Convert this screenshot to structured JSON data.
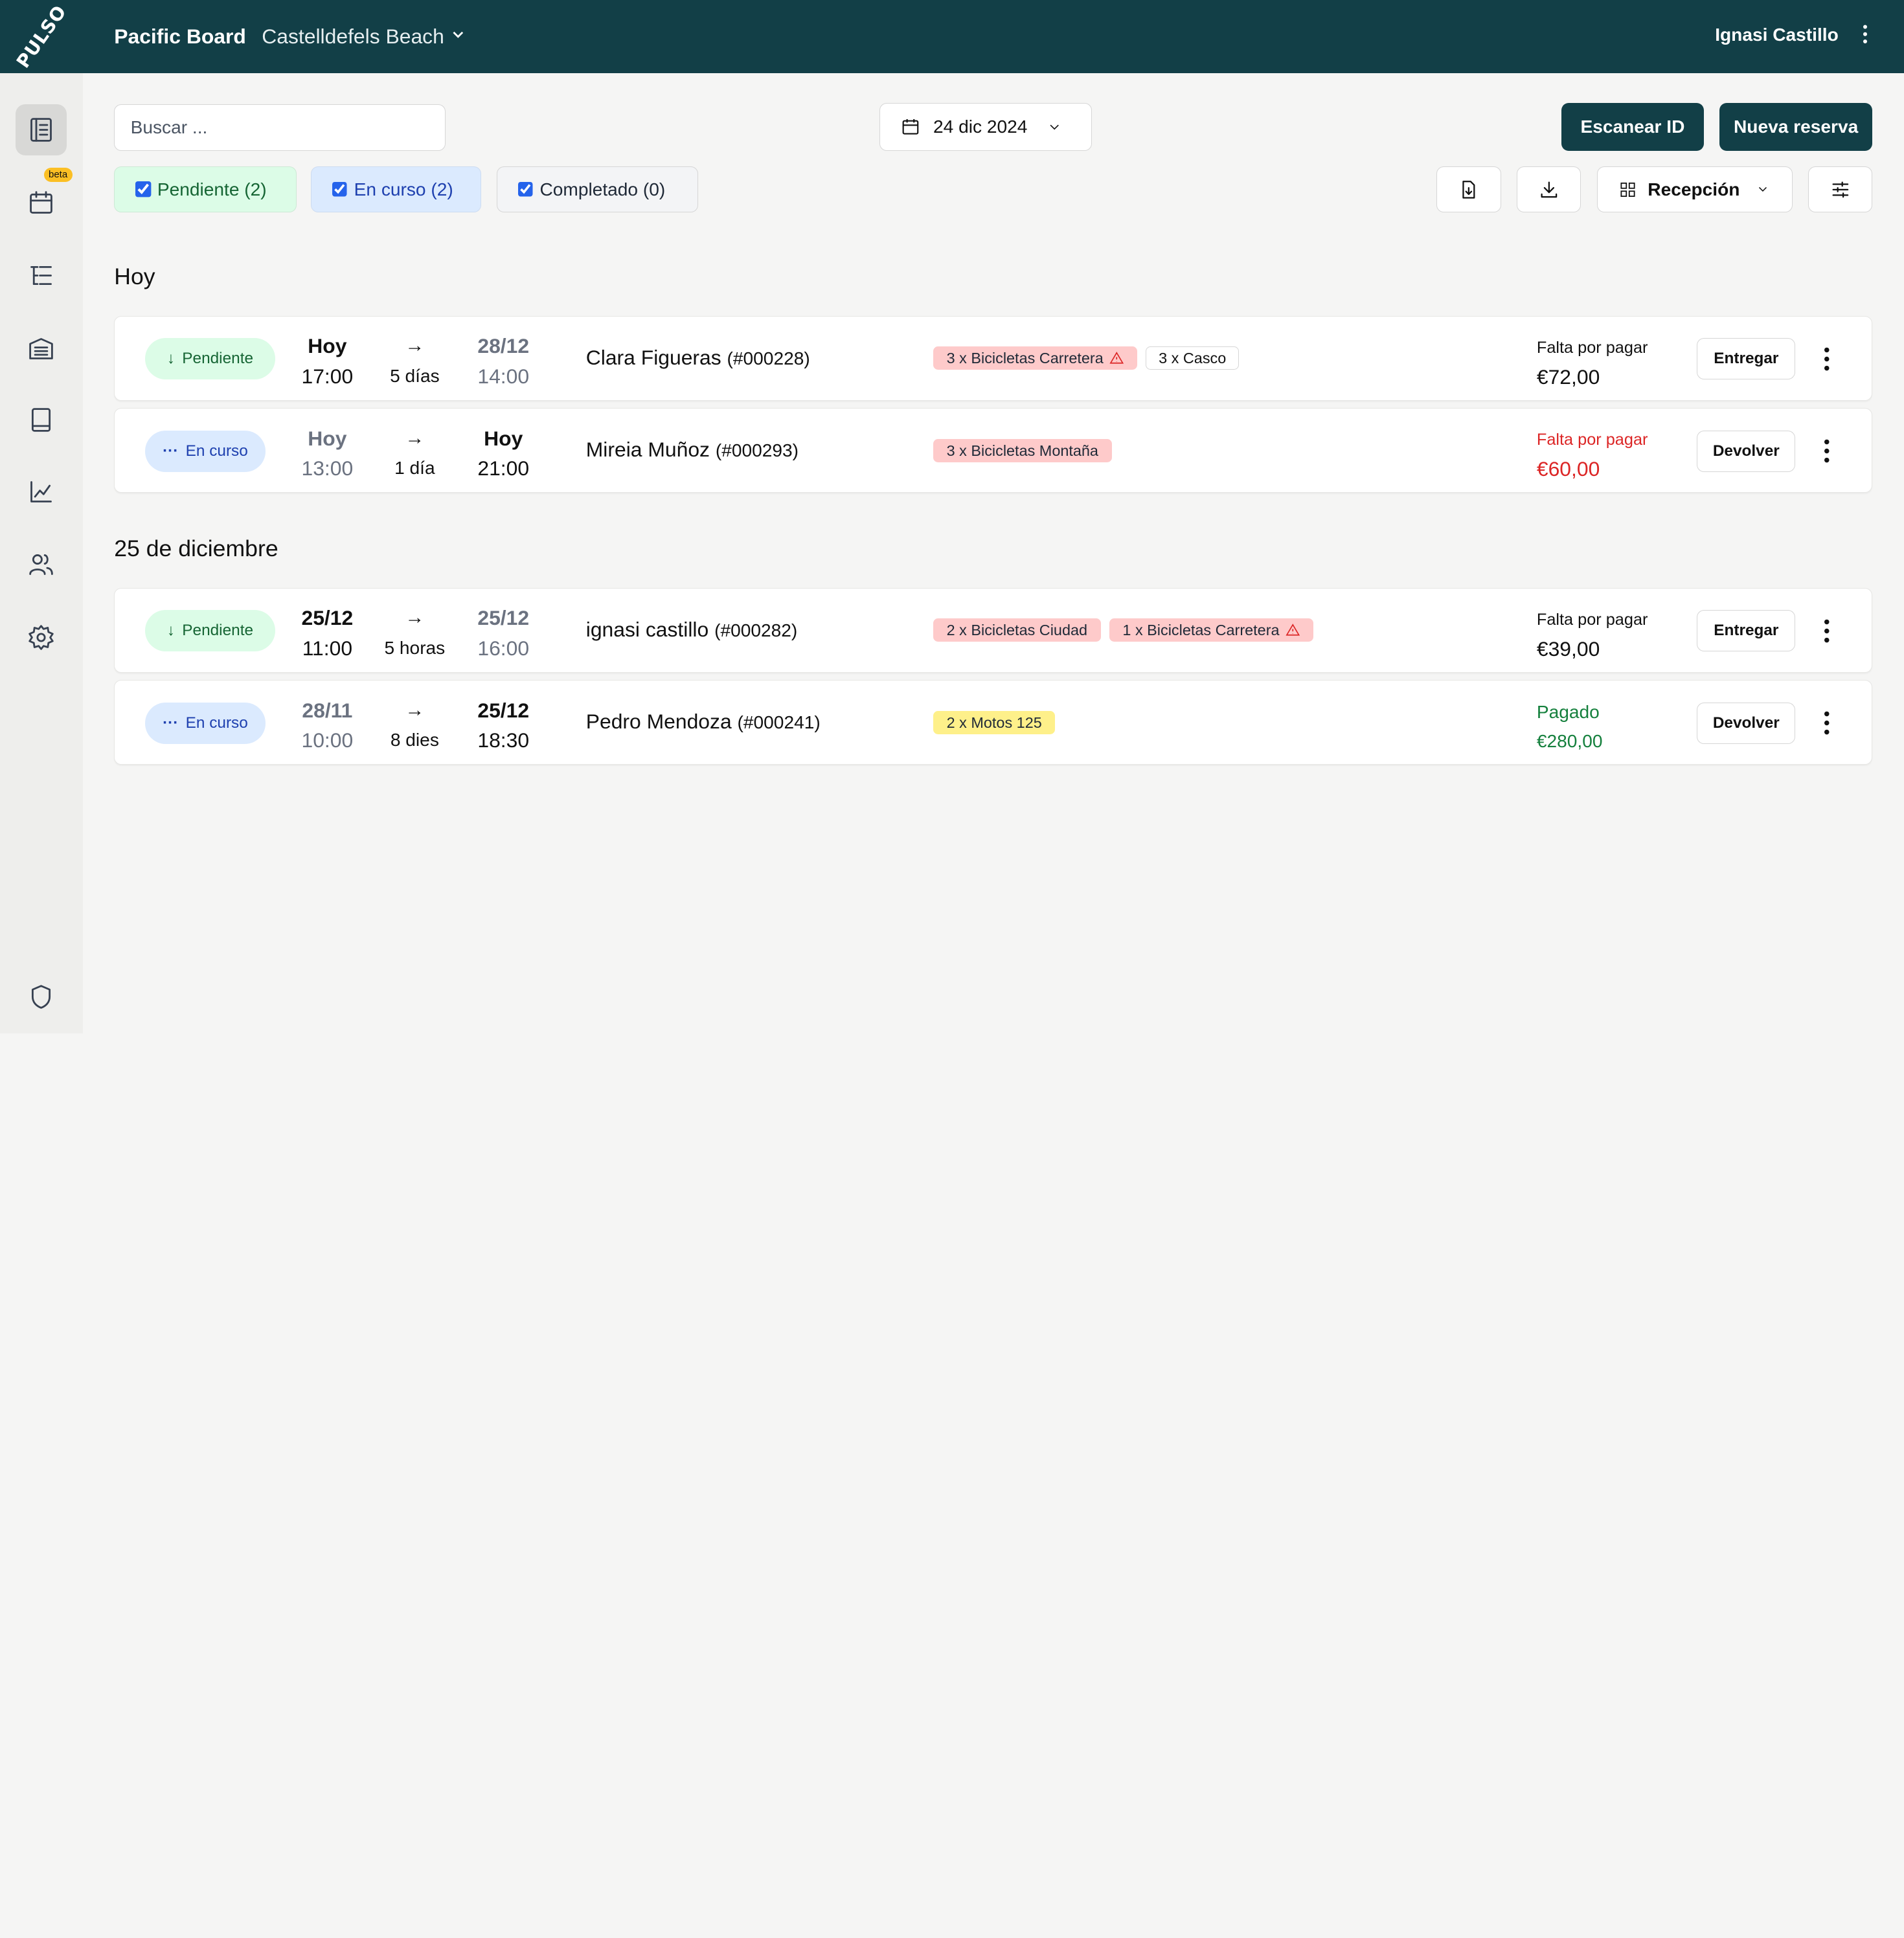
{
  "header": {
    "logo": "PULSO",
    "app_title": "Pacific Board",
    "location": "Castelldefels Beach",
    "user_name": "Ignasi Castillo"
  },
  "sidebar": {
    "items": [
      "bookings-icon",
      "calendar-icon",
      "list-icon",
      "inventory-icon",
      "book-icon",
      "chart-icon",
      "users-icon",
      "settings-icon",
      "shield-icon"
    ],
    "beta_badge": "beta"
  },
  "toolbar": {
    "search_placeholder": "Buscar ...",
    "date": "24 dic 2024",
    "scan_label": "Escanear ID",
    "new_label": "Nueva reserva",
    "view_label": "Recepción"
  },
  "filters": [
    {
      "label": "Pendiente (2)",
      "checked": true
    },
    {
      "label": "En curso (2)",
      "checked": true
    },
    {
      "label": "Completado (0)",
      "checked": true
    }
  ],
  "sections": [
    {
      "title": "Hoy",
      "rows": [
        {
          "status": "Pendiente",
          "start_day": "Hoy",
          "start_time": "17:00",
          "duration": "5 días",
          "end_day": "28/12",
          "end_time": "14:00",
          "customer": "Clara Figueras",
          "booking_id": "(#000228)",
          "items": [
            "3 x Bicicletas Carretera",
            "3 x Casco"
          ],
          "pay_label": "Falta por pagar",
          "pay_amount": "€72,00",
          "action": "Entregar"
        },
        {
          "status": "En curso",
          "start_day": "Hoy",
          "start_time": "13:00",
          "duration": "1 día",
          "end_day": "Hoy",
          "end_time": "21:00",
          "customer": "Mireia Muñoz",
          "booking_id": "(#000293)",
          "items": [
            "3 x Bicicletas Montaña"
          ],
          "pay_label": "Falta por pagar",
          "pay_amount": "€60,00",
          "action": "Devolver"
        }
      ]
    },
    {
      "title": "25 de diciembre",
      "rows": [
        {
          "status": "Pendiente",
          "start_day": "25/12",
          "start_time": "11:00",
          "duration": "5 horas",
          "end_day": "25/12",
          "end_time": "16:00",
          "customer": "ignasi castillo",
          "booking_id": "(#000282)",
          "items": [
            "2 x Bicicletas Ciudad",
            "1 x Bicicletas Carretera"
          ],
          "pay_label": "Falta por pagar",
          "pay_amount": "€39,00",
          "action": "Entregar"
        },
        {
          "status": "En curso",
          "start_day": "28/11",
          "start_time": "10:00",
          "duration": "8 dies",
          "end_day": "25/12",
          "end_time": "18:30",
          "customer": "Pedro Mendoza",
          "booking_id": "(#000241)",
          "items": [
            "2 x Motos 125"
          ],
          "pay_label": "Pagado",
          "pay_amount": "€280,00",
          "action": "Devolver"
        }
      ]
    }
  ],
  "colors": {
    "brand": "#123f47",
    "pending_bg": "#dcfce7",
    "in_progress_bg": "#dbeafe",
    "due": "#dc2626",
    "paid": "#15803d",
    "tag_red": "#fecaca",
    "tag_yellow": "#fef08a"
  }
}
